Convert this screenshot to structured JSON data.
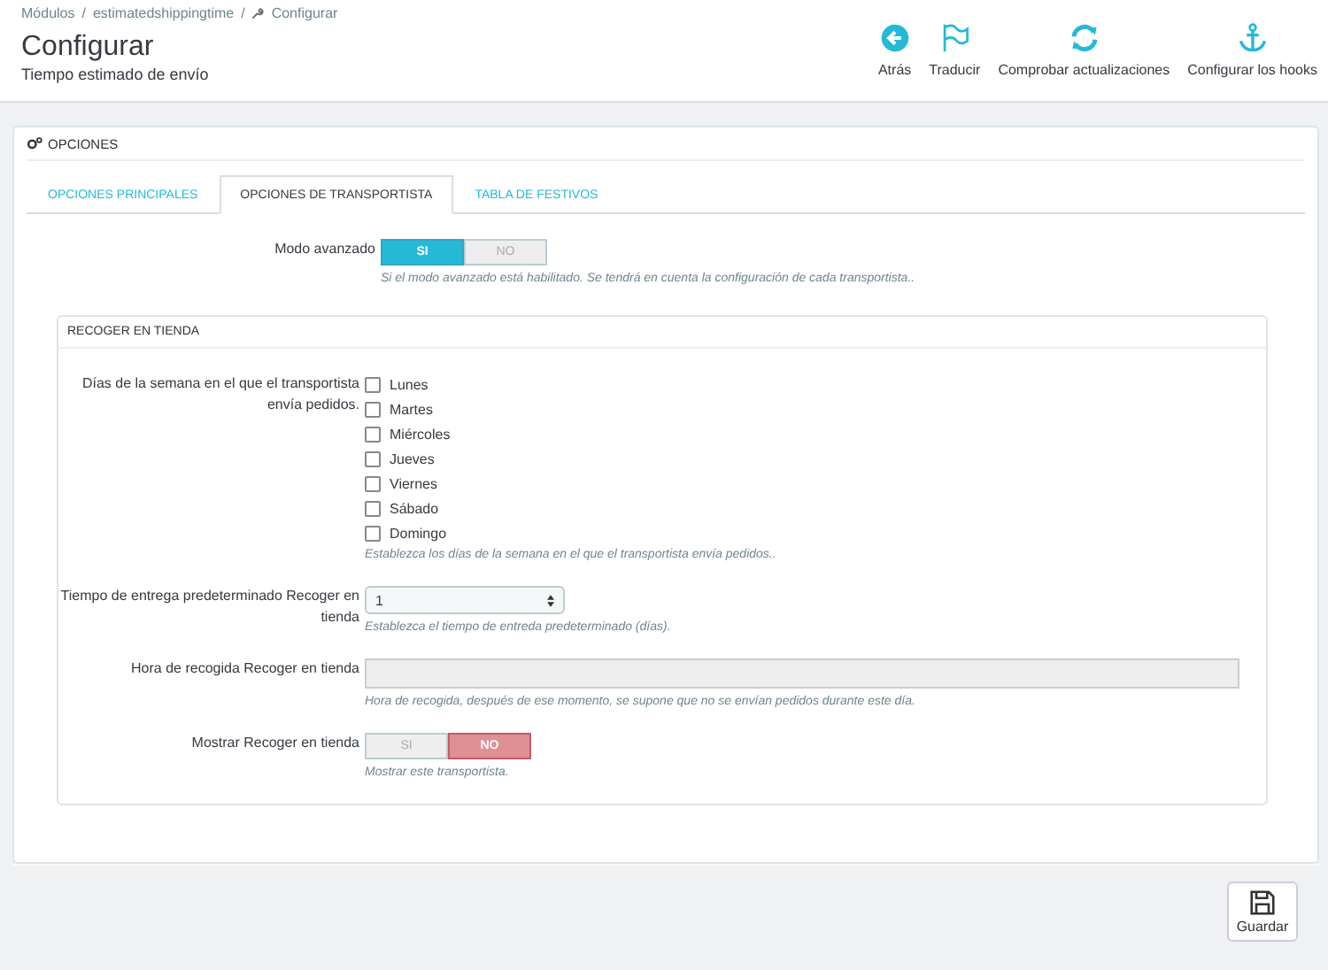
{
  "breadcrumb": [
    "Módulos",
    "estimatedshippingtime",
    "Configurar"
  ],
  "breadcrumb_separator": "/",
  "page_title": "Configurar",
  "page_subtitle": "Tiempo estimado de envío",
  "toolbar": [
    {
      "label": "Atrás",
      "kind": "back"
    },
    {
      "label": "Traducir",
      "kind": "flag"
    },
    {
      "label": "Comprobar actualizaciones",
      "kind": "refresh"
    },
    {
      "label": "Configurar los hooks",
      "kind": "anchor"
    }
  ],
  "panel": {
    "title": "OPCIONES",
    "tabs": [
      {
        "label": "OPCIONES PRINCIPALES",
        "selected": false
      },
      {
        "label": "OPCIONES DE TRANSPORTISTA",
        "selected": true
      },
      {
        "label": "TABLA DE FESTIVOS",
        "selected": false
      }
    ],
    "fields": [
      {
        "kind": "switch",
        "label": "Modo avanzado",
        "options": [
          {
            "label": "SI",
            "selected": true
          },
          {
            "label": "NO",
            "selected": false
          }
        ],
        "help": "Si el modo avanzado está habilitado. Se tendrá en cuenta la configuración de cada transportista.."
      }
    ],
    "fieldset": {
      "title": "RECOGER EN TIENDA",
      "fields": [
        {
          "kind": "checkboxes",
          "label": "Días de la semana en el que el transportista envía pedidos.",
          "options": [
            {
              "label": "Lunes",
              "checked": false
            },
            {
              "label": "Martes",
              "checked": false
            },
            {
              "label": "Miércoles",
              "checked": false
            },
            {
              "label": "Jueves",
              "checked": false
            },
            {
              "label": "Viernes",
              "checked": false
            },
            {
              "label": "Sábado",
              "checked": false
            },
            {
              "label": "Domingo",
              "checked": false
            }
          ],
          "help": "Establezca los días de la semana en el que el transportista envía pedidos.."
        },
        {
          "kind": "select",
          "label": "Tiempo de entrega predeterminado Recoger en tienda",
          "value": "1",
          "help": "Establezca el tiempo de entreda predeterminado (días)."
        },
        {
          "kind": "text",
          "label": "Hora de recogida Recoger en tienda",
          "disabled": true,
          "help": "Hora de recogida, después de ese momento, se supone que no se envían pedidos durante este día."
        },
        {
          "kind": "switch",
          "label": "Mostrar Recoger en tienda",
          "options": [
            {
              "label": "SI",
              "selected": false
            },
            {
              "label": "NO",
              "selected": true
            }
          ],
          "help": "Mostrar este transportista."
        }
      ]
    }
  },
  "save_button": {
    "label": "Guardar"
  }
}
